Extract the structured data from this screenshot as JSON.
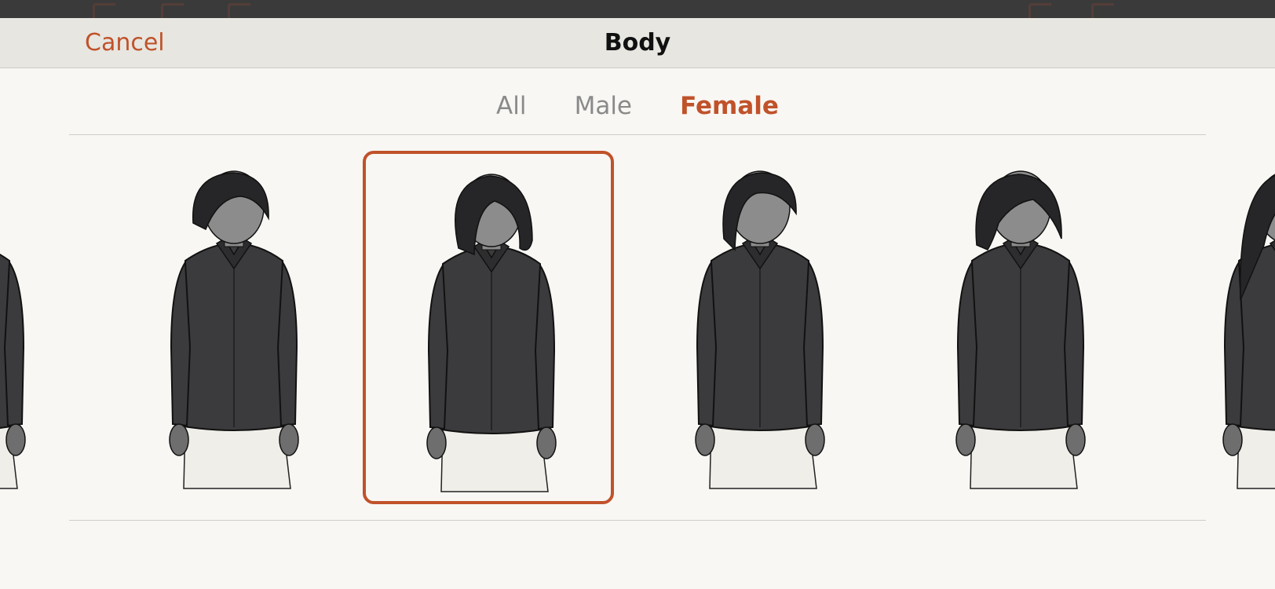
{
  "header": {
    "cancel_label": "Cancel",
    "title": "Body"
  },
  "tabs": [
    {
      "label": "All",
      "active": false
    },
    {
      "label": "Male",
      "active": false
    },
    {
      "label": "Female",
      "active": true
    }
  ],
  "bodies": [
    {
      "id": "female-0",
      "hair": "short",
      "selected": false
    },
    {
      "id": "female-1",
      "hair": "short-bob",
      "selected": false
    },
    {
      "id": "female-2",
      "hair": "bob",
      "selected": true
    },
    {
      "id": "female-3",
      "hair": "slicked-back",
      "selected": false
    },
    {
      "id": "female-4",
      "hair": "curly-bob",
      "selected": false
    },
    {
      "id": "female-5",
      "hair": "long",
      "selected": false
    }
  ],
  "colors": {
    "accent": "#c0522a",
    "header_bg": "#e7e6e1",
    "page_bg": "#f8f7f4",
    "shirt": "#3b3b3d",
    "pants": "#efeee8"
  },
  "icons": {
    "back": "chevron-left-icon",
    "undo": "undo-icon",
    "redo": "redo-icon",
    "pen": "pen-icon",
    "share": "share-icon"
  }
}
